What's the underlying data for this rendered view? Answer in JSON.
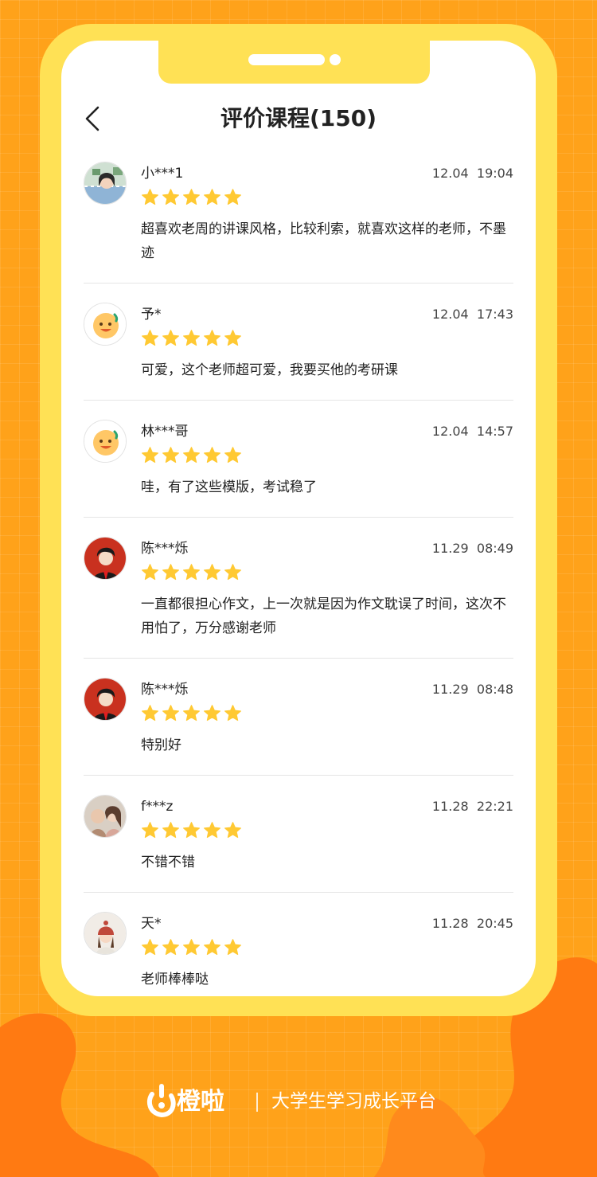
{
  "header": {
    "title": "评价课程(150)"
  },
  "colors": {
    "accent": "#ffa21a",
    "phone_frame": "#ffe155",
    "star": "#ffc933"
  },
  "reviews": [
    {
      "name": "小***1",
      "time": "12.04  19:04",
      "rating": 5,
      "comment": "超喜欢老周的讲课风格，比较利索，就喜欢这样的老师，不墨迹",
      "avatar": "photo-girl-avatar"
    },
    {
      "name": "予*",
      "time": "12.04  17:43",
      "rating": 5,
      "comment": "可爱，这个老师超可爱，我要买他的考研课",
      "avatar": "smiley-avatar"
    },
    {
      "name": "林***哥",
      "time": "12.04  14:57",
      "rating": 5,
      "comment": "哇，有了这些模版，考试稳了",
      "avatar": "smiley-avatar"
    },
    {
      "name": "陈***烁",
      "time": "11.29  08:49",
      "rating": 5,
      "comment": "一直都很担心作文，上一次就是因为作文耽误了时间，这次不用怕了，万分感谢老师",
      "avatar": "illustrated-boy-avatar"
    },
    {
      "name": "陈***烁",
      "time": "11.29  08:48",
      "rating": 5,
      "comment": "特别好",
      "avatar": "illustrated-boy-avatar"
    },
    {
      "name": "f***z",
      "time": "11.28  22:21",
      "rating": 5,
      "comment": "不错不错",
      "avatar": "photo-pair-avatar"
    },
    {
      "name": "天*",
      "time": "11.28  20:45",
      "rating": 5,
      "comment": "老师棒棒哒",
      "avatar": "illustrated-girl-hat-avatar"
    }
  ],
  "brand": {
    "logo_text": "橙啦",
    "slogan": "大学生学习成长平台"
  }
}
